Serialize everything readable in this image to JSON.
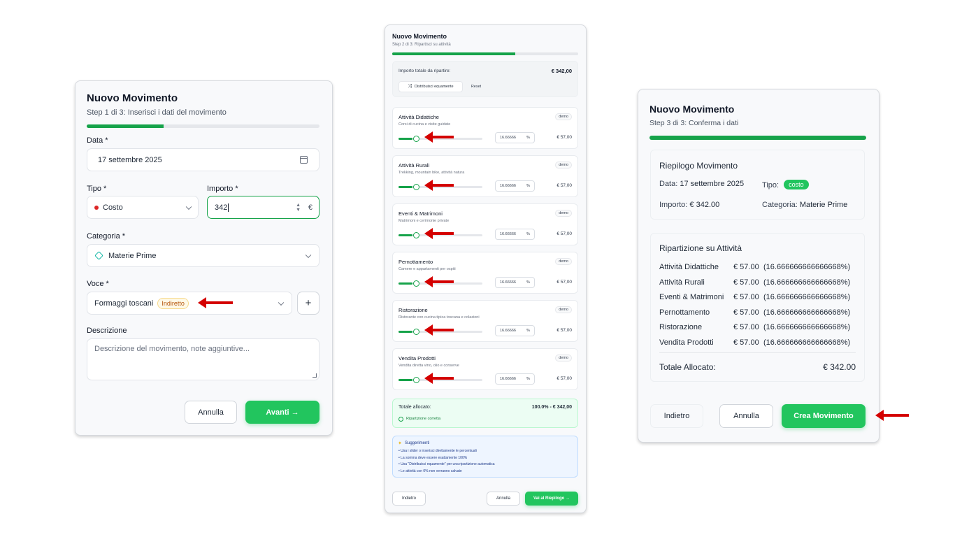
{
  "step1": {
    "title": "Nuovo Movimento",
    "subtitle": "Step 1 di 3: Inserisci i dati del movimento",
    "progress_pct": 33,
    "date_label": "Data *",
    "date_value": "17 settembre 2025",
    "type_label": "Tipo *",
    "type_value": "Costo",
    "amount_label": "Importo *",
    "amount_value": "342",
    "currency": "€",
    "category_label": "Categoria *",
    "category_value": "Materie Prime",
    "item_label": "Voce *",
    "item_value": "Formaggi toscani",
    "item_tag": "Indiretto",
    "add_symbol": "+",
    "description_label": "Descrizione",
    "description_placeholder": "Descrizione del movimento, note aggiuntive...",
    "cancel_label": "Annulla",
    "next_label": "Avanti →"
  },
  "step2": {
    "title": "Nuovo Movimento",
    "subtitle": "Step 2 di 3: Ripartisci su attività",
    "progress_pct": 66,
    "total_label": "Importo totale da ripartire:",
    "total_value": "€ 342,00",
    "distribute_label": "Distribuisci equamente",
    "reset_label": "Reset",
    "activities": [
      {
        "name": "Attività Didattiche",
        "desc": "Corsi di cucina e visite guidate",
        "badge": "demo",
        "pct": "16.66666",
        "pct_symbol": "%",
        "amount": "€ 57,00",
        "slider": 16.67
      },
      {
        "name": "Attività Rurali",
        "desc": "Trekking, mountain bike, attività natura",
        "badge": "demo",
        "pct": "16.66666",
        "pct_symbol": "%",
        "amount": "€ 57,00",
        "slider": 16.67
      },
      {
        "name": "Eventi & Matrimoni",
        "desc": "Matrimoni e cerimonie private",
        "badge": "demo",
        "pct": "16.66666",
        "pct_symbol": "%",
        "amount": "€ 57,00",
        "slider": 16.67
      },
      {
        "name": "Pernottamento",
        "desc": "Camere e appartamenti per ospiti",
        "badge": "demo",
        "pct": "16.66666",
        "pct_symbol": "%",
        "amount": "€ 57,00",
        "slider": 16.67
      },
      {
        "name": "Ristorazione",
        "desc": "Ristorante con cucina tipica toscana e colazioni",
        "badge": "demo",
        "pct": "16.66666",
        "pct_symbol": "%",
        "amount": "€ 57,00",
        "slider": 16.67
      },
      {
        "name": "Vendita Prodotti",
        "desc": "Vendita diretta vino, olio e conserve",
        "badge": "demo",
        "pct": "16.66666",
        "pct_symbol": "%",
        "amount": "€ 57,00",
        "slider": 16.67
      }
    ],
    "allocated_label": "Totale allocato:",
    "allocated_value": "100.0% - € 342,00",
    "allocated_status": "Ripartizione corretta",
    "tips_title": "Suggerimenti",
    "tips": [
      "• Usa i slider o inserisci direttamente le percentuali",
      "• La somma deve essere esattamente 100%",
      "• Usa \"Distribuisci equamente\" per una ripartizione automatica",
      "• Le attività con 0% non verranno salvate"
    ],
    "back_label": "Indietro",
    "cancel_label": "Annulla",
    "next_label": "Vai al Riepilogo →"
  },
  "step3": {
    "title": "Nuovo Movimento",
    "subtitle": "Step 3 di 3: Conferma i dati",
    "progress_pct": 100,
    "summary_title": "Riepilogo Movimento",
    "date_key": "Data:",
    "date_value": "17 settembre 2025",
    "type_key": "Tipo:",
    "type_value": "costo",
    "amount_key": "Importo:",
    "amount_value": "€ 342.00",
    "category_key": "Categoria:",
    "category_value": "Materie Prime",
    "split_title": "Ripartizione su Attività",
    "rows": [
      {
        "name": "Attività Didattiche",
        "amount": "€ 57.00",
        "pct": "(16.666666666666668%)"
      },
      {
        "name": "Attività Rurali",
        "amount": "€ 57.00",
        "pct": "(16.666666666666668%)"
      },
      {
        "name": "Eventi & Matrimoni",
        "amount": "€ 57.00",
        "pct": "(16.666666666666668%)"
      },
      {
        "name": "Pernottamento",
        "amount": "€ 57.00",
        "pct": "(16.666666666666668%)"
      },
      {
        "name": "Ristorazione",
        "amount": "€ 57.00",
        "pct": "(16.666666666666668%)"
      },
      {
        "name": "Vendita Prodotti",
        "amount": "€ 57.00",
        "pct": "(16.666666666666668%)"
      }
    ],
    "total_label": "Totale Allocato:",
    "total_value": "€ 342.00",
    "back_label": "Indietro",
    "cancel_label": "Annulla",
    "create_label": "Crea Movimento"
  },
  "colors": {
    "accent": "#22c55e",
    "progress": "#16a34a",
    "annotation_arrow": "#d40000",
    "type_dot": "#dc2626"
  }
}
